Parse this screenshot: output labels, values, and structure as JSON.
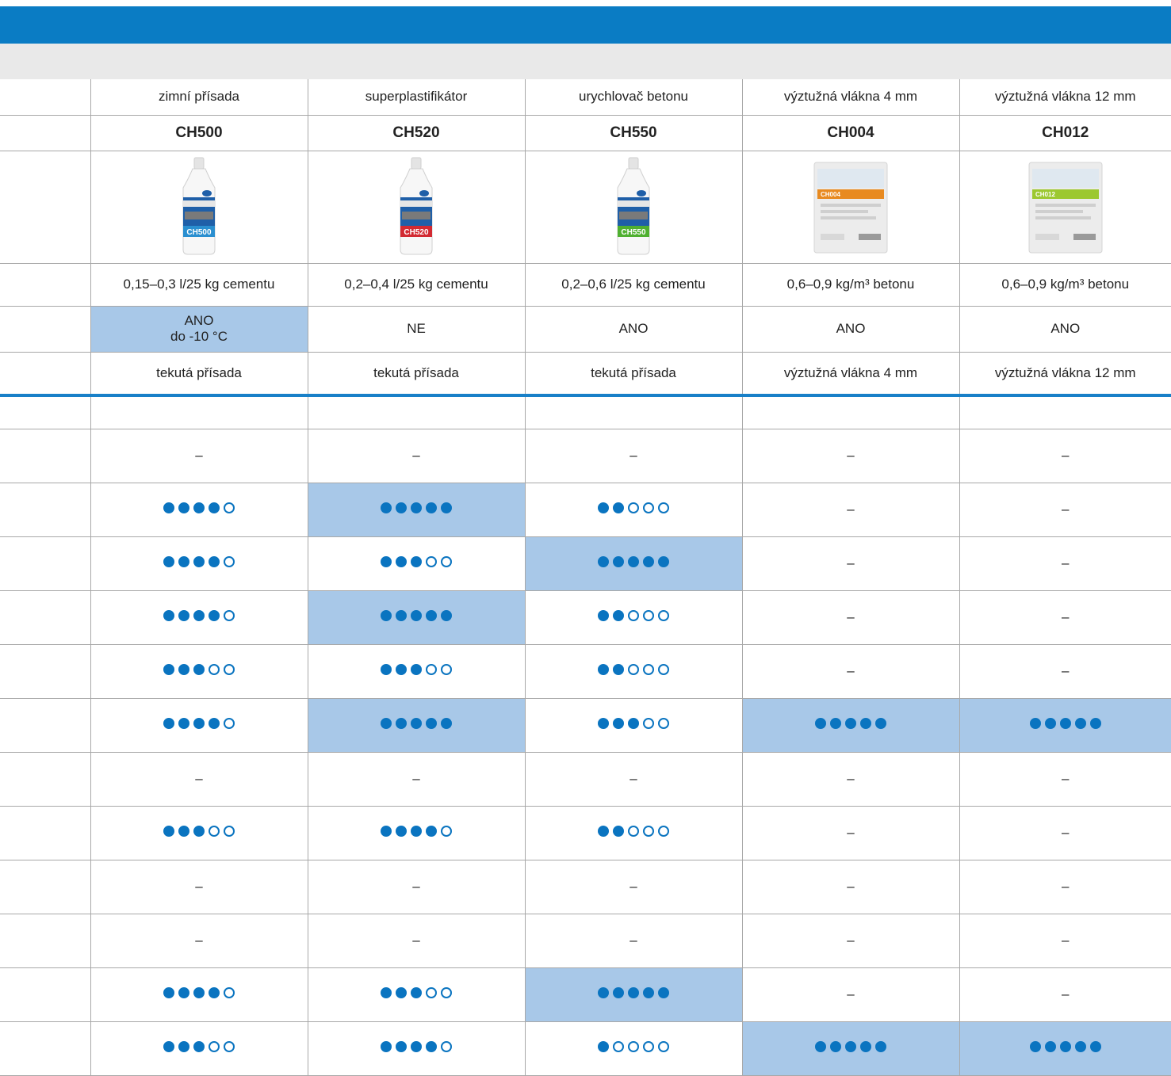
{
  "colors": {
    "header_blue": "#0a7cc4",
    "highlight": "#a8c8e8",
    "dot": "#0a74c0",
    "grid": "#a8a8a8",
    "subbar": "#e9e9e9"
  },
  "products": [
    {
      "category": "zimní přísada",
      "code": "CH500",
      "image": "bottle-icon",
      "dosage": "0,15–0,3 l/25 kg cementu",
      "frost": {
        "lines": [
          "ANO",
          "do -10 °C"
        ],
        "highlight": true
      },
      "form": "tekutá přísada"
    },
    {
      "category": "superplastifikátor",
      "code": "CH520",
      "image": "bottle-icon",
      "dosage": "0,2–0,4 l/25 kg cementu",
      "frost": {
        "lines": [
          "NE"
        ],
        "highlight": false
      },
      "form": "tekutá přísada"
    },
    {
      "category": "urychlovač betonu",
      "code": "CH550",
      "image": "bottle-icon",
      "dosage": "0,2–0,6 l/25 kg cementu",
      "frost": {
        "lines": [
          "ANO"
        ],
        "highlight": false
      },
      "form": "tekutá přísada"
    },
    {
      "category": "výztužná vlákna 4 mm",
      "code": "CH004",
      "image": "fiber-bag-icon",
      "dosage": "0,6–0,9 kg/m³ betonu",
      "frost": {
        "lines": [
          "ANO"
        ],
        "highlight": false
      },
      "form": "výztužná vlákna 4 mm"
    },
    {
      "category": "výztužná vlákna 12 mm",
      "code": "CH012",
      "image": "fiber-bag-icon",
      "dosage": "0,6–0,9 kg/m³ betonu",
      "frost": {
        "lines": [
          "ANO"
        ],
        "highlight": false
      },
      "form": "výztužná vlákna 12 mm"
    }
  ],
  "dash": "–",
  "ratings": [
    [
      null,
      null,
      null,
      null,
      null
    ],
    [
      0,
      0,
      0,
      0,
      0
    ],
    [
      4,
      5,
      2,
      0,
      0
    ],
    [
      4,
      3,
      5,
      0,
      0
    ],
    [
      4,
      5,
      2,
      0,
      0
    ],
    [
      3,
      3,
      2,
      0,
      0
    ],
    [
      4,
      5,
      3,
      5,
      5
    ],
    [
      0,
      0,
      0,
      0,
      0
    ],
    [
      3,
      4,
      2,
      0,
      0
    ],
    [
      0,
      0,
      0,
      0,
      0
    ],
    [
      0,
      0,
      0,
      0,
      0
    ],
    [
      4,
      3,
      5,
      0,
      0
    ],
    [
      3,
      4,
      1,
      5,
      5
    ]
  ],
  "rating_max": 5,
  "highlights": [
    [
      false,
      false,
      false,
      false,
      false
    ],
    [
      false,
      false,
      false,
      false,
      false
    ],
    [
      false,
      true,
      false,
      false,
      false
    ],
    [
      false,
      false,
      true,
      false,
      false
    ],
    [
      false,
      true,
      false,
      false,
      false
    ],
    [
      false,
      false,
      false,
      false,
      false
    ],
    [
      false,
      true,
      false,
      true,
      true
    ],
    [
      false,
      false,
      false,
      false,
      false
    ],
    [
      false,
      false,
      false,
      false,
      false
    ],
    [
      false,
      false,
      false,
      false,
      false
    ],
    [
      false,
      false,
      false,
      false,
      false
    ],
    [
      false,
      false,
      true,
      false,
      false
    ],
    [
      false,
      false,
      false,
      true,
      true
    ]
  ]
}
